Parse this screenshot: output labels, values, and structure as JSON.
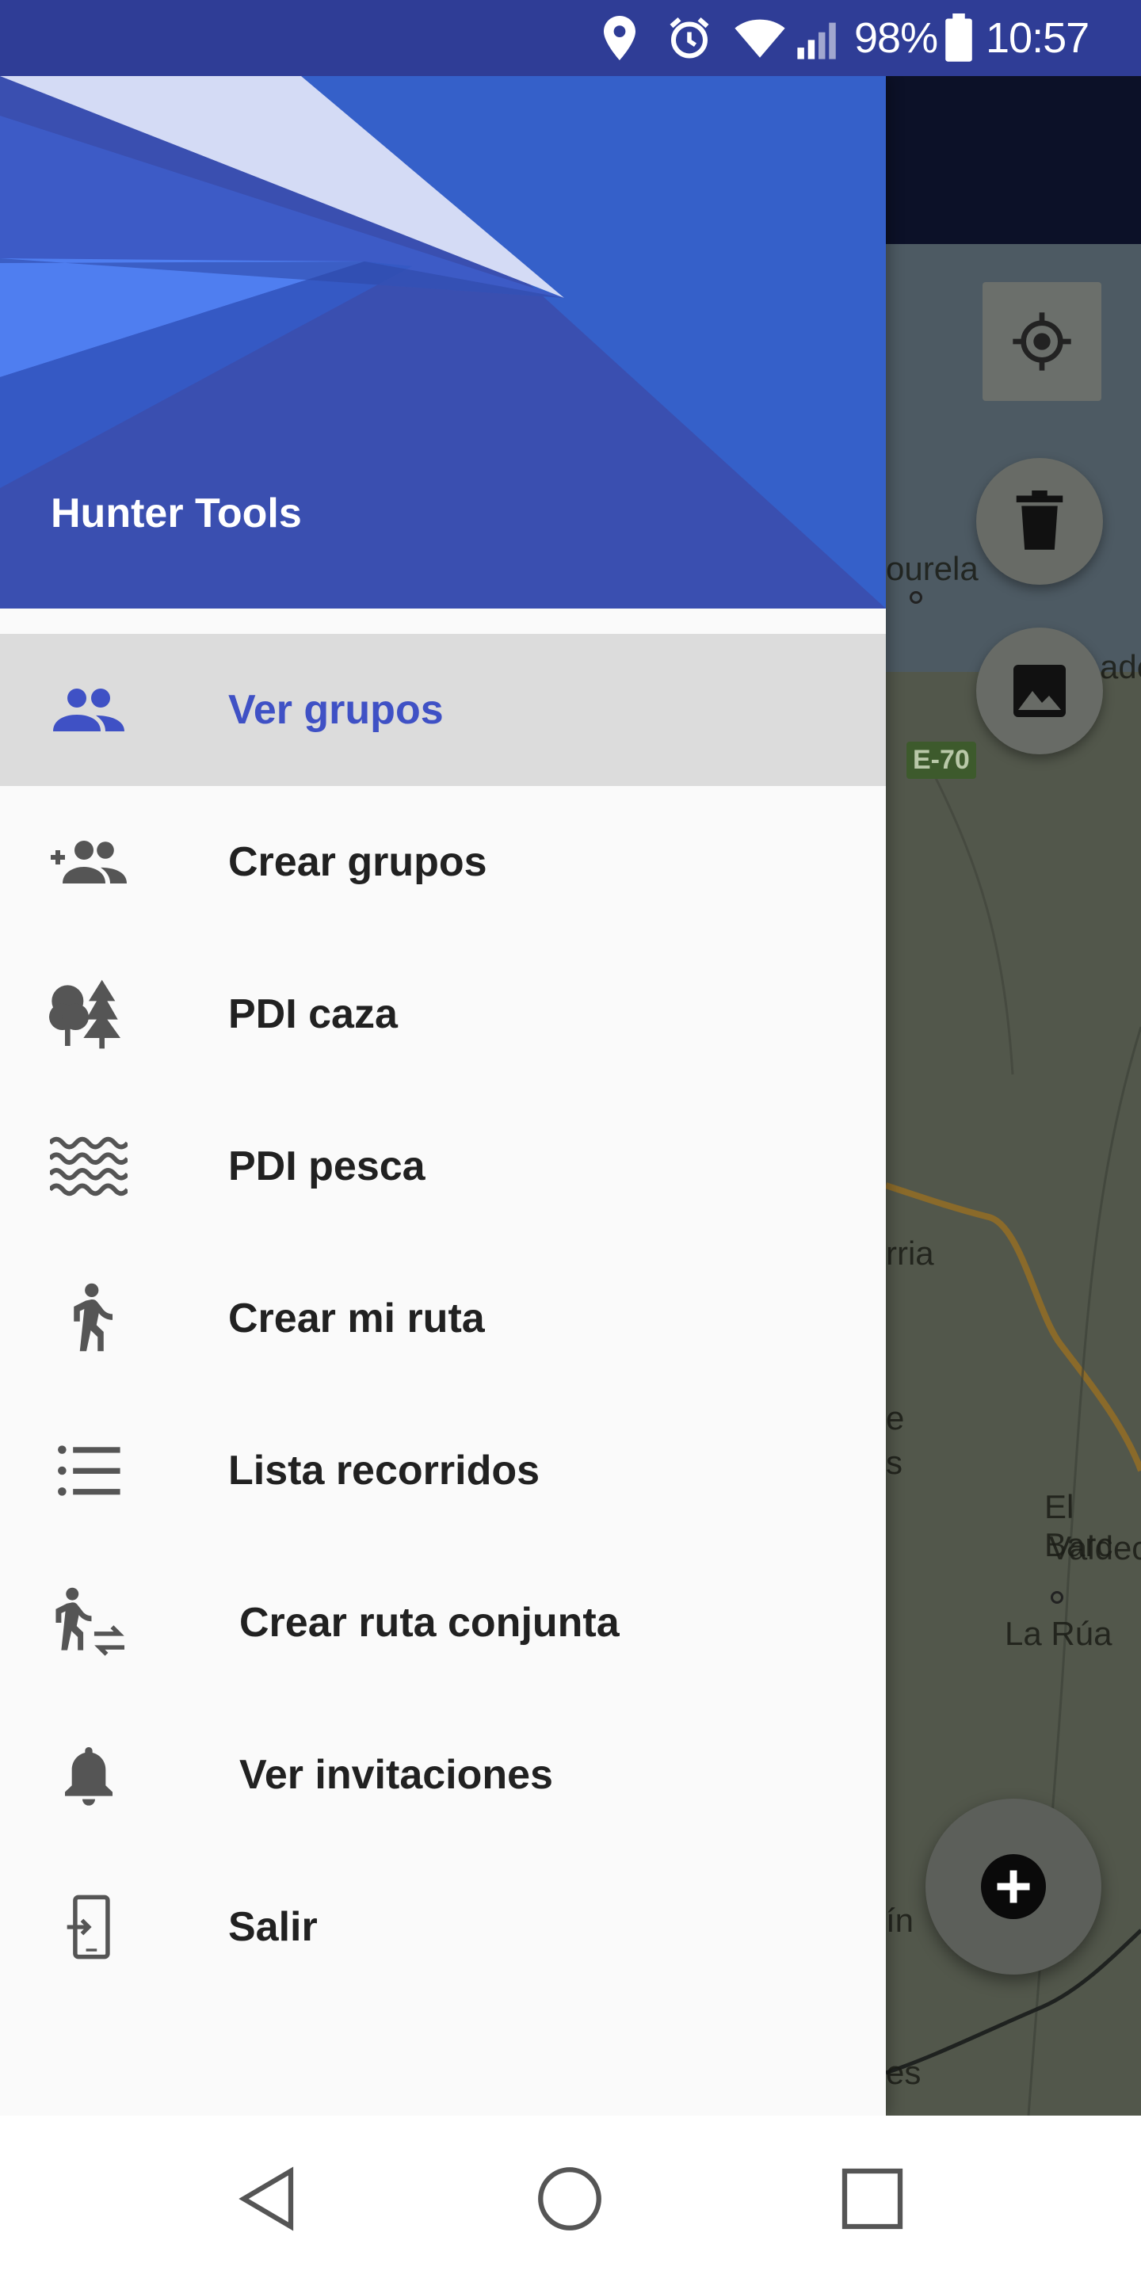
{
  "status_bar": {
    "battery_percent": "98%",
    "time": "10:57",
    "icons": [
      "location-icon",
      "alarm-icon",
      "wifi-icon",
      "signal-icon",
      "battery-icon"
    ]
  },
  "drawer": {
    "app_title": "Hunter Tools",
    "menu": [
      {
        "label": "Ver grupos",
        "icon": "group-icon",
        "active": true
      },
      {
        "label": "Crear grupos",
        "icon": "group-add-icon",
        "active": false
      },
      {
        "label": "PDI caza",
        "icon": "trees-icon",
        "active": false
      },
      {
        "label": "PDI pesca",
        "icon": "waves-icon",
        "active": false
      },
      {
        "label": "Crear mi ruta",
        "icon": "walk-icon",
        "active": false
      },
      {
        "label": "Lista recorridos",
        "icon": "list-icon",
        "active": false
      },
      {
        "label": "Crear ruta conjunta",
        "icon": "walk-swap-icon",
        "active": false
      },
      {
        "label": "Ver invitaciones",
        "icon": "bell-icon",
        "active": false
      },
      {
        "label": "Salir",
        "icon": "exit-icon",
        "active": false
      }
    ]
  },
  "map": {
    "labels": [
      "ourela",
      "ade",
      "rria",
      "e",
      "s",
      "El Barc",
      "Valdec",
      "La Rúa",
      "ín",
      "es"
    ],
    "road_badge": "E-70"
  },
  "colors": {
    "primary": "#2f3d96",
    "accent_active": "#3f51c5",
    "active_row": "#dcdcdc"
  }
}
